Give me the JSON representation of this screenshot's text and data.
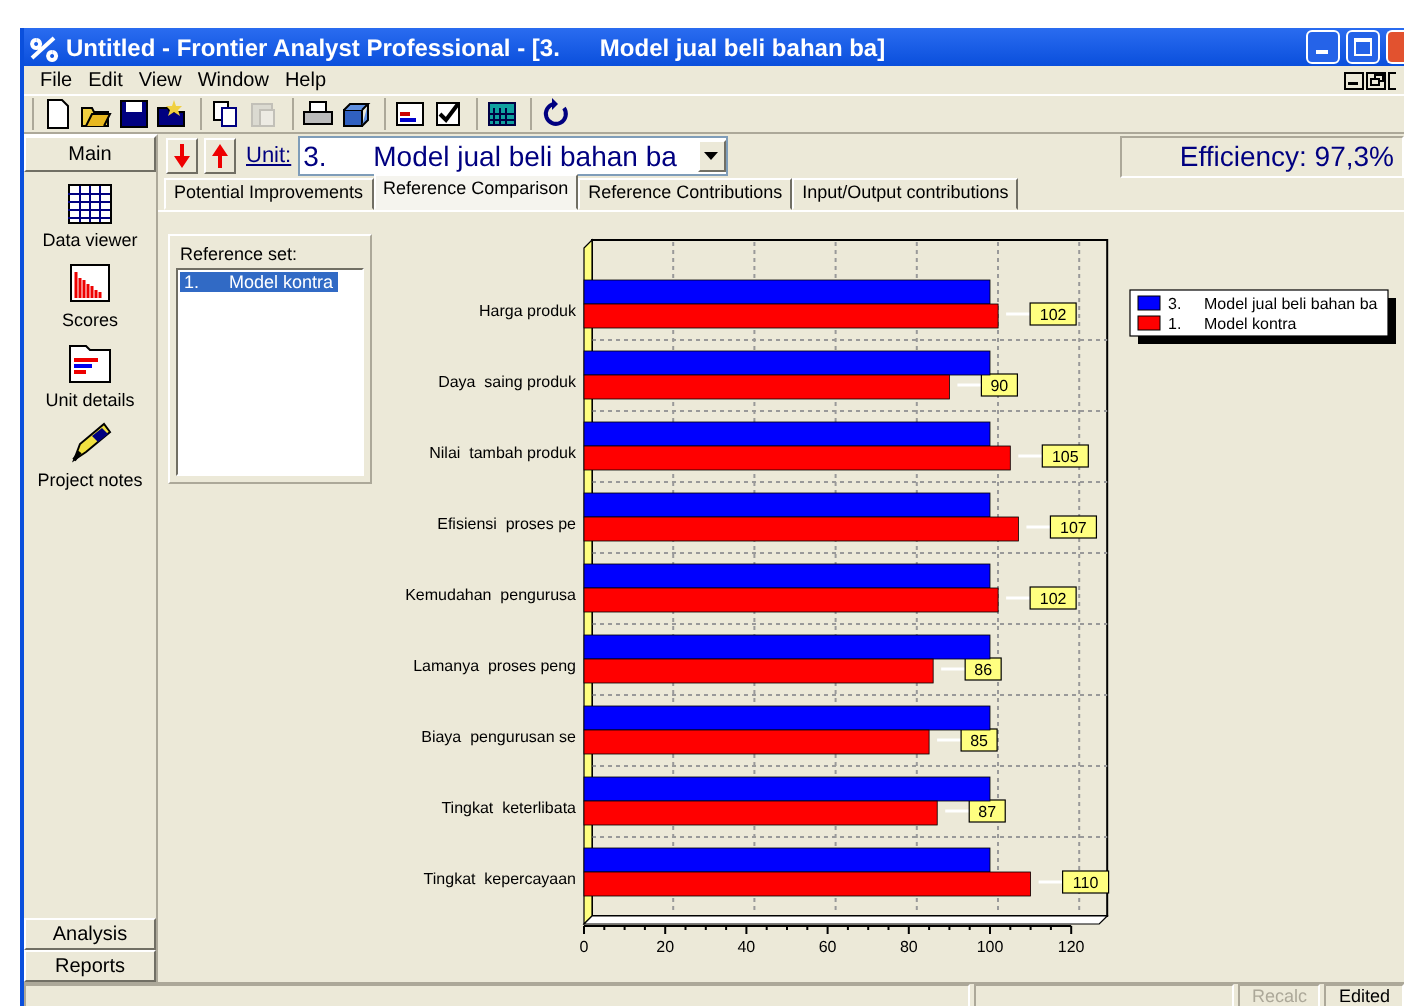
{
  "window": {
    "title": "Untitled - Frontier Analyst Professional - [3.      Model jual beli bahan ba]"
  },
  "menu": [
    "File",
    "Edit",
    "View",
    "Window",
    "Help"
  ],
  "toolbar": [
    [
      {
        "kind": "new",
        "disabled": false
      },
      {
        "kind": "open",
        "disabled": false
      },
      {
        "kind": "save",
        "disabled": false
      },
      {
        "kind": "folder",
        "disabled": false
      }
    ],
    [
      {
        "kind": "copy",
        "disabled": false
      },
      {
        "kind": "paste",
        "disabled": true
      }
    ],
    [
      {
        "kind": "print",
        "disabled": false
      },
      {
        "kind": "boxes",
        "disabled": false
      }
    ],
    [
      {
        "kind": "chart",
        "disabled": false
      },
      {
        "kind": "check",
        "disabled": false
      }
    ],
    [
      {
        "kind": "table",
        "disabled": false
      }
    ],
    [
      {
        "kind": "refresh",
        "disabled": false
      }
    ]
  ],
  "sidebar": {
    "header": "Main",
    "items": [
      {
        "kind": "grid",
        "label": "Data viewer"
      },
      {
        "kind": "bars",
        "label": "Scores"
      },
      {
        "kind": "folder",
        "label": "Unit details"
      },
      {
        "kind": "pen",
        "label": "Project notes"
      }
    ],
    "footer": [
      "Analysis",
      "Reports"
    ]
  },
  "unit": {
    "label": "Unit:",
    "value": "3.      Model jual beli bahan ba"
  },
  "efficiency": "Efficiency: 97,3%",
  "tabs": [
    {
      "label": "Potential Improvements",
      "selected": false
    },
    {
      "label": "Reference Comparison",
      "selected": true
    },
    {
      "label": "Reference Contributions",
      "selected": false
    },
    {
      "label": "Input/Output contributions",
      "selected": false
    }
  ],
  "reference_set": {
    "label": "Reference set:",
    "items": [
      {
        "text": "1.      Model kontra",
        "selected": true
      }
    ]
  },
  "chart": {
    "legend_numbers": [
      "3.",
      "1."
    ],
    "chart_data": {
      "type": "bar",
      "orientation": "horizontal",
      "categories": [
        "Harga produk",
        "Daya  saing produk",
        "Nilai  tambah produk",
        "Efisiensi  proses pe",
        "Kemudahan  pengurusa",
        "Lamanya  proses peng",
        "Biaya  pengurusan se",
        "Tingkat  keterlibata",
        "Tingkat  kepercayaan"
      ],
      "series": [
        {
          "name": "Model jual beli bahan ba",
          "color": "#0000ff",
          "values": [
            100,
            100,
            100,
            100,
            100,
            100,
            100,
            100,
            100
          ]
        },
        {
          "name": "Model kontra",
          "color": "#ff0000",
          "values": [
            102,
            90,
            105,
            107,
            102,
            86,
            85,
            87,
            110
          ]
        }
      ],
      "xlim": [
        0,
        120
      ],
      "xticks": [
        0,
        20,
        40,
        60,
        80,
        100,
        120
      ],
      "value_labels": [
        "102",
        "90",
        "105",
        "107",
        "102",
        "86",
        "85",
        "87",
        "110"
      ]
    }
  },
  "status_bar": [
    {
      "text": "Recalc",
      "disabled": true
    },
    {
      "text": "Edited",
      "disabled": false
    }
  ]
}
